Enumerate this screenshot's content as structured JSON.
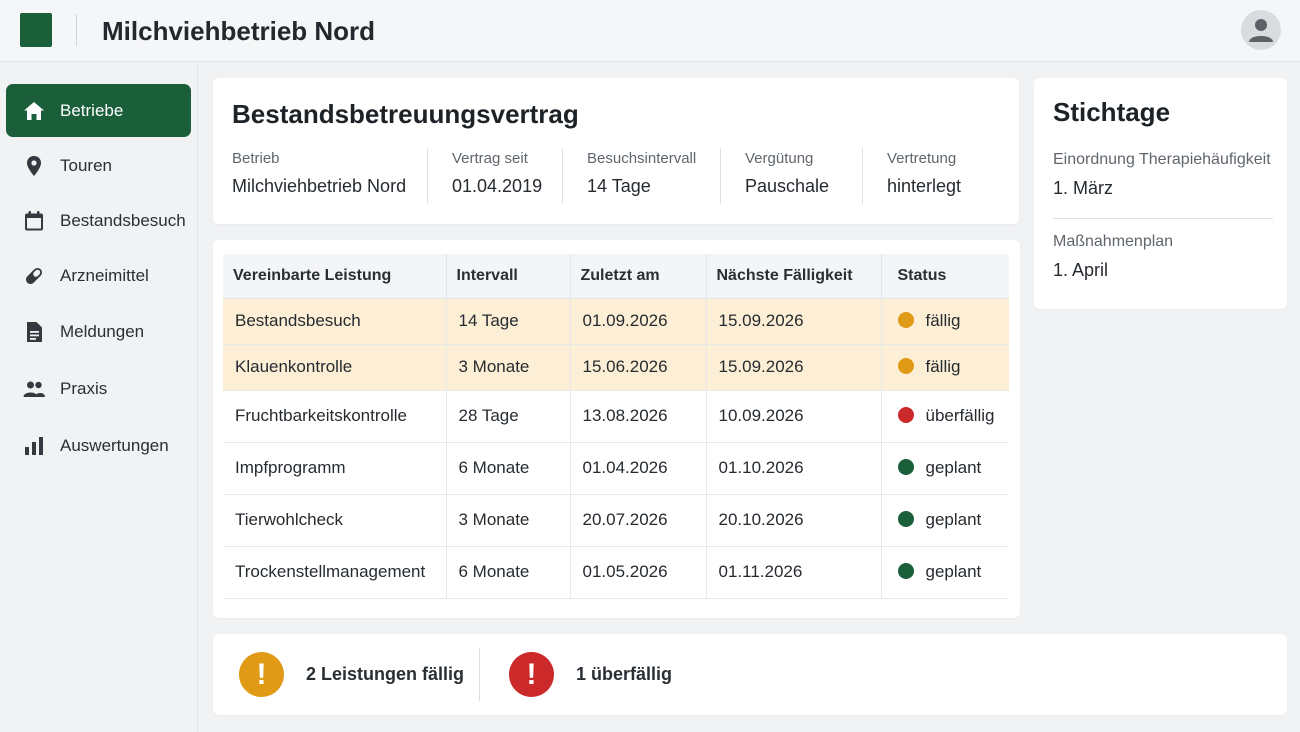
{
  "colors": {
    "brand": "#1b5e3a",
    "due": "#e09a15",
    "overdue": "#cc2a2a",
    "planned": "#1b5e3a",
    "row_highlight": "#fdefd6"
  },
  "header": {
    "title": "Milchviehbetrieb Nord",
    "logo_icon": "brand-logo",
    "avatar_icon": "user-avatar-icon"
  },
  "sidebar": {
    "items": [
      {
        "label": "Betriebe",
        "icon": "home-icon",
        "active": true
      },
      {
        "label": "Touren",
        "icon": "map-pin-icon",
        "active": false
      },
      {
        "label": "Bestandsbesuch",
        "icon": "calendar-icon",
        "active": false
      },
      {
        "label": "Arzneimittel",
        "icon": "pill-icon",
        "active": false
      },
      {
        "label": "Meldungen",
        "icon": "document-icon",
        "active": false
      },
      {
        "label": "Praxis",
        "icon": "people-icon",
        "active": false
      },
      {
        "label": "Auswertungen",
        "icon": "bar-chart-icon",
        "active": false
      }
    ]
  },
  "contract": {
    "title": "Bestandsbetreuungsvertrag",
    "fields": [
      {
        "label": "Betrieb",
        "value": "Milchviehbetrieb Nord"
      },
      {
        "label": "Vertrag seit",
        "value": "01.04.2019"
      },
      {
        "label": "Besuchsintervall",
        "value": "14 Tage"
      },
      {
        "label": "Vergütung",
        "value": "Pauschale"
      },
      {
        "label": "Vertretung",
        "value": "hinterlegt"
      }
    ]
  },
  "services": {
    "columns": [
      "Vereinbarte Leistung",
      "Intervall",
      "Zuletzt am",
      "Nächste Fälligkeit",
      "Status"
    ],
    "rows": [
      {
        "name": "Bestandsbesuch",
        "interval": "14 Tage",
        "last": "01.09.2026",
        "next": "15.09.2026",
        "status": "fällig",
        "status_color": "#e09a15",
        "highlight": true
      },
      {
        "name": "Klauenkontrolle",
        "interval": "3 Monate",
        "last": "15.06.2026",
        "next": "15.09.2026",
        "status": "fällig",
        "status_color": "#e09a15",
        "highlight": true
      },
      {
        "name": "Fruchtbarkeitskontrolle",
        "interval": "28 Tage",
        "last": "13.08.2026",
        "next": "10.09.2026",
        "status": "überfällig",
        "status_color": "#cc2a2a",
        "highlight": false
      },
      {
        "name": "Impfprogramm",
        "interval": "6 Monate",
        "last": "01.04.2026",
        "next": "01.10.2026",
        "status": "geplant",
        "status_color": "#1b5e3a",
        "highlight": false
      },
      {
        "name": "Tierwohlcheck",
        "interval": "3 Monate",
        "last": "20.07.2026",
        "next": "20.10.2026",
        "status": "geplant",
        "status_color": "#1b5e3a",
        "highlight": false
      },
      {
        "name": "Trockenstellmanagement",
        "interval": "6 Monate",
        "last": "01.05.2026",
        "next": "01.11.2026",
        "status": "geplant",
        "status_color": "#1b5e3a",
        "highlight": false
      }
    ]
  },
  "key_dates": {
    "title": "Stichtage",
    "items": [
      {
        "label": "Einordnung Therapiehäufigkeit",
        "value": "1. März"
      },
      {
        "label": "Maßnahmenplan",
        "value": "1. April"
      }
    ]
  },
  "summary": {
    "due_text": "2 Leistungen fällig",
    "overdue_text": "1 überfällig",
    "icon_glyph": "!",
    "due_icon": "warning-icon",
    "overdue_icon": "alert-icon"
  }
}
